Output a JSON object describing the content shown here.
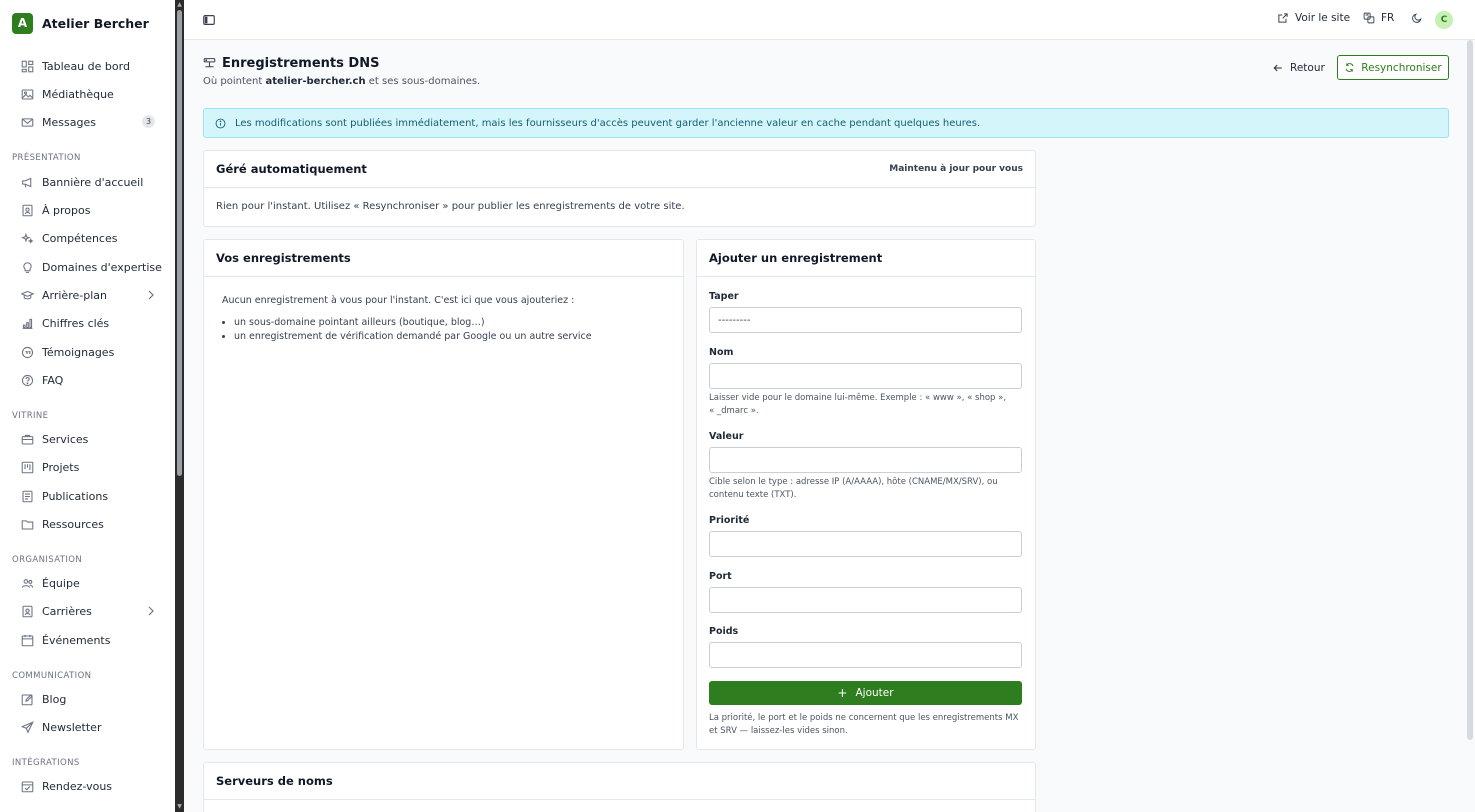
{
  "brand": {
    "initial": "A",
    "name": "Atelier Bercher"
  },
  "sidebar": {
    "top_items": [
      {
        "label": "Tableau de bord"
      },
      {
        "label": "Médiathèque"
      },
      {
        "label": "Messages",
        "badge": "3"
      }
    ],
    "sections": [
      {
        "title": "PRÉSENTATION",
        "items": [
          "Bannière d'accueil",
          "À propos",
          "Compétences",
          "Domaines d'expertise",
          "Arrière-plan",
          "Chiffres clés",
          "Témoignages",
          "FAQ"
        ]
      },
      {
        "title": "VITRINE",
        "items": [
          "Services",
          "Projets",
          "Publications",
          "Ressources"
        ]
      },
      {
        "title": "ORGANISATION",
        "items": [
          "Équipe",
          "Carrières",
          "Événements"
        ]
      },
      {
        "title": "COMMUNICATION",
        "items": [
          "Blog",
          "Newsletter"
        ]
      },
      {
        "title": "INTÉGRATIONS",
        "items": [
          "Rendez-vous"
        ]
      }
    ]
  },
  "topbar": {
    "view_site": "Voir le site",
    "language": "FR",
    "avatar": "C"
  },
  "page": {
    "title": "Enregistrements DNS",
    "subtitle_prefix": "Où pointent ",
    "subtitle_domain": "atelier-bercher.ch",
    "subtitle_suffix": " et ses sous-domaines.",
    "back_label": "Retour",
    "resync_label": "Resynchroniser"
  },
  "alert": {
    "text": "Les modifications sont publiées immédiatement, mais les fournisseurs d'accès peuvent garder l'ancienne valeur en cache pendant quelques heures."
  },
  "auto_card": {
    "title": "Géré automatiquement",
    "meta": "Maintenu à jour pour vous",
    "body": "Rien pour l'instant. Utilisez « Resynchroniser » pour publier les enregistrements de votre site."
  },
  "records_card": {
    "title": "Vos enregistrements",
    "intro": "Aucun enregistrement à vous pour l'instant. C'est ici que vous ajouteriez :",
    "bullets": [
      "un sous-domaine pointant ailleurs (boutique, blog…)",
      "un enregistrement de vérification demandé par Google ou un autre service"
    ]
  },
  "add_card": {
    "title": "Ajouter un enregistrement",
    "type_label": "Taper",
    "type_value": "---------",
    "name_label": "Nom",
    "name_help": "Laisser vide pour le domaine lui-même. Exemple : « www », « shop », « _dmarc ».",
    "value_label": "Valeur",
    "value_help": "Cible selon le type : adresse IP (A/AAAA), hôte (CNAME/MX/SRV), ou contenu texte (TXT).",
    "priority_label": "Priorité",
    "port_label": "Port",
    "weight_label": "Poids",
    "add_button": "Ajouter",
    "footer_help": "La priorité, le port et le poids ne concernent que les enregistrements MX et SRV — laissez-les vides sinon."
  },
  "ns_card": {
    "title": "Serveurs de noms"
  }
}
